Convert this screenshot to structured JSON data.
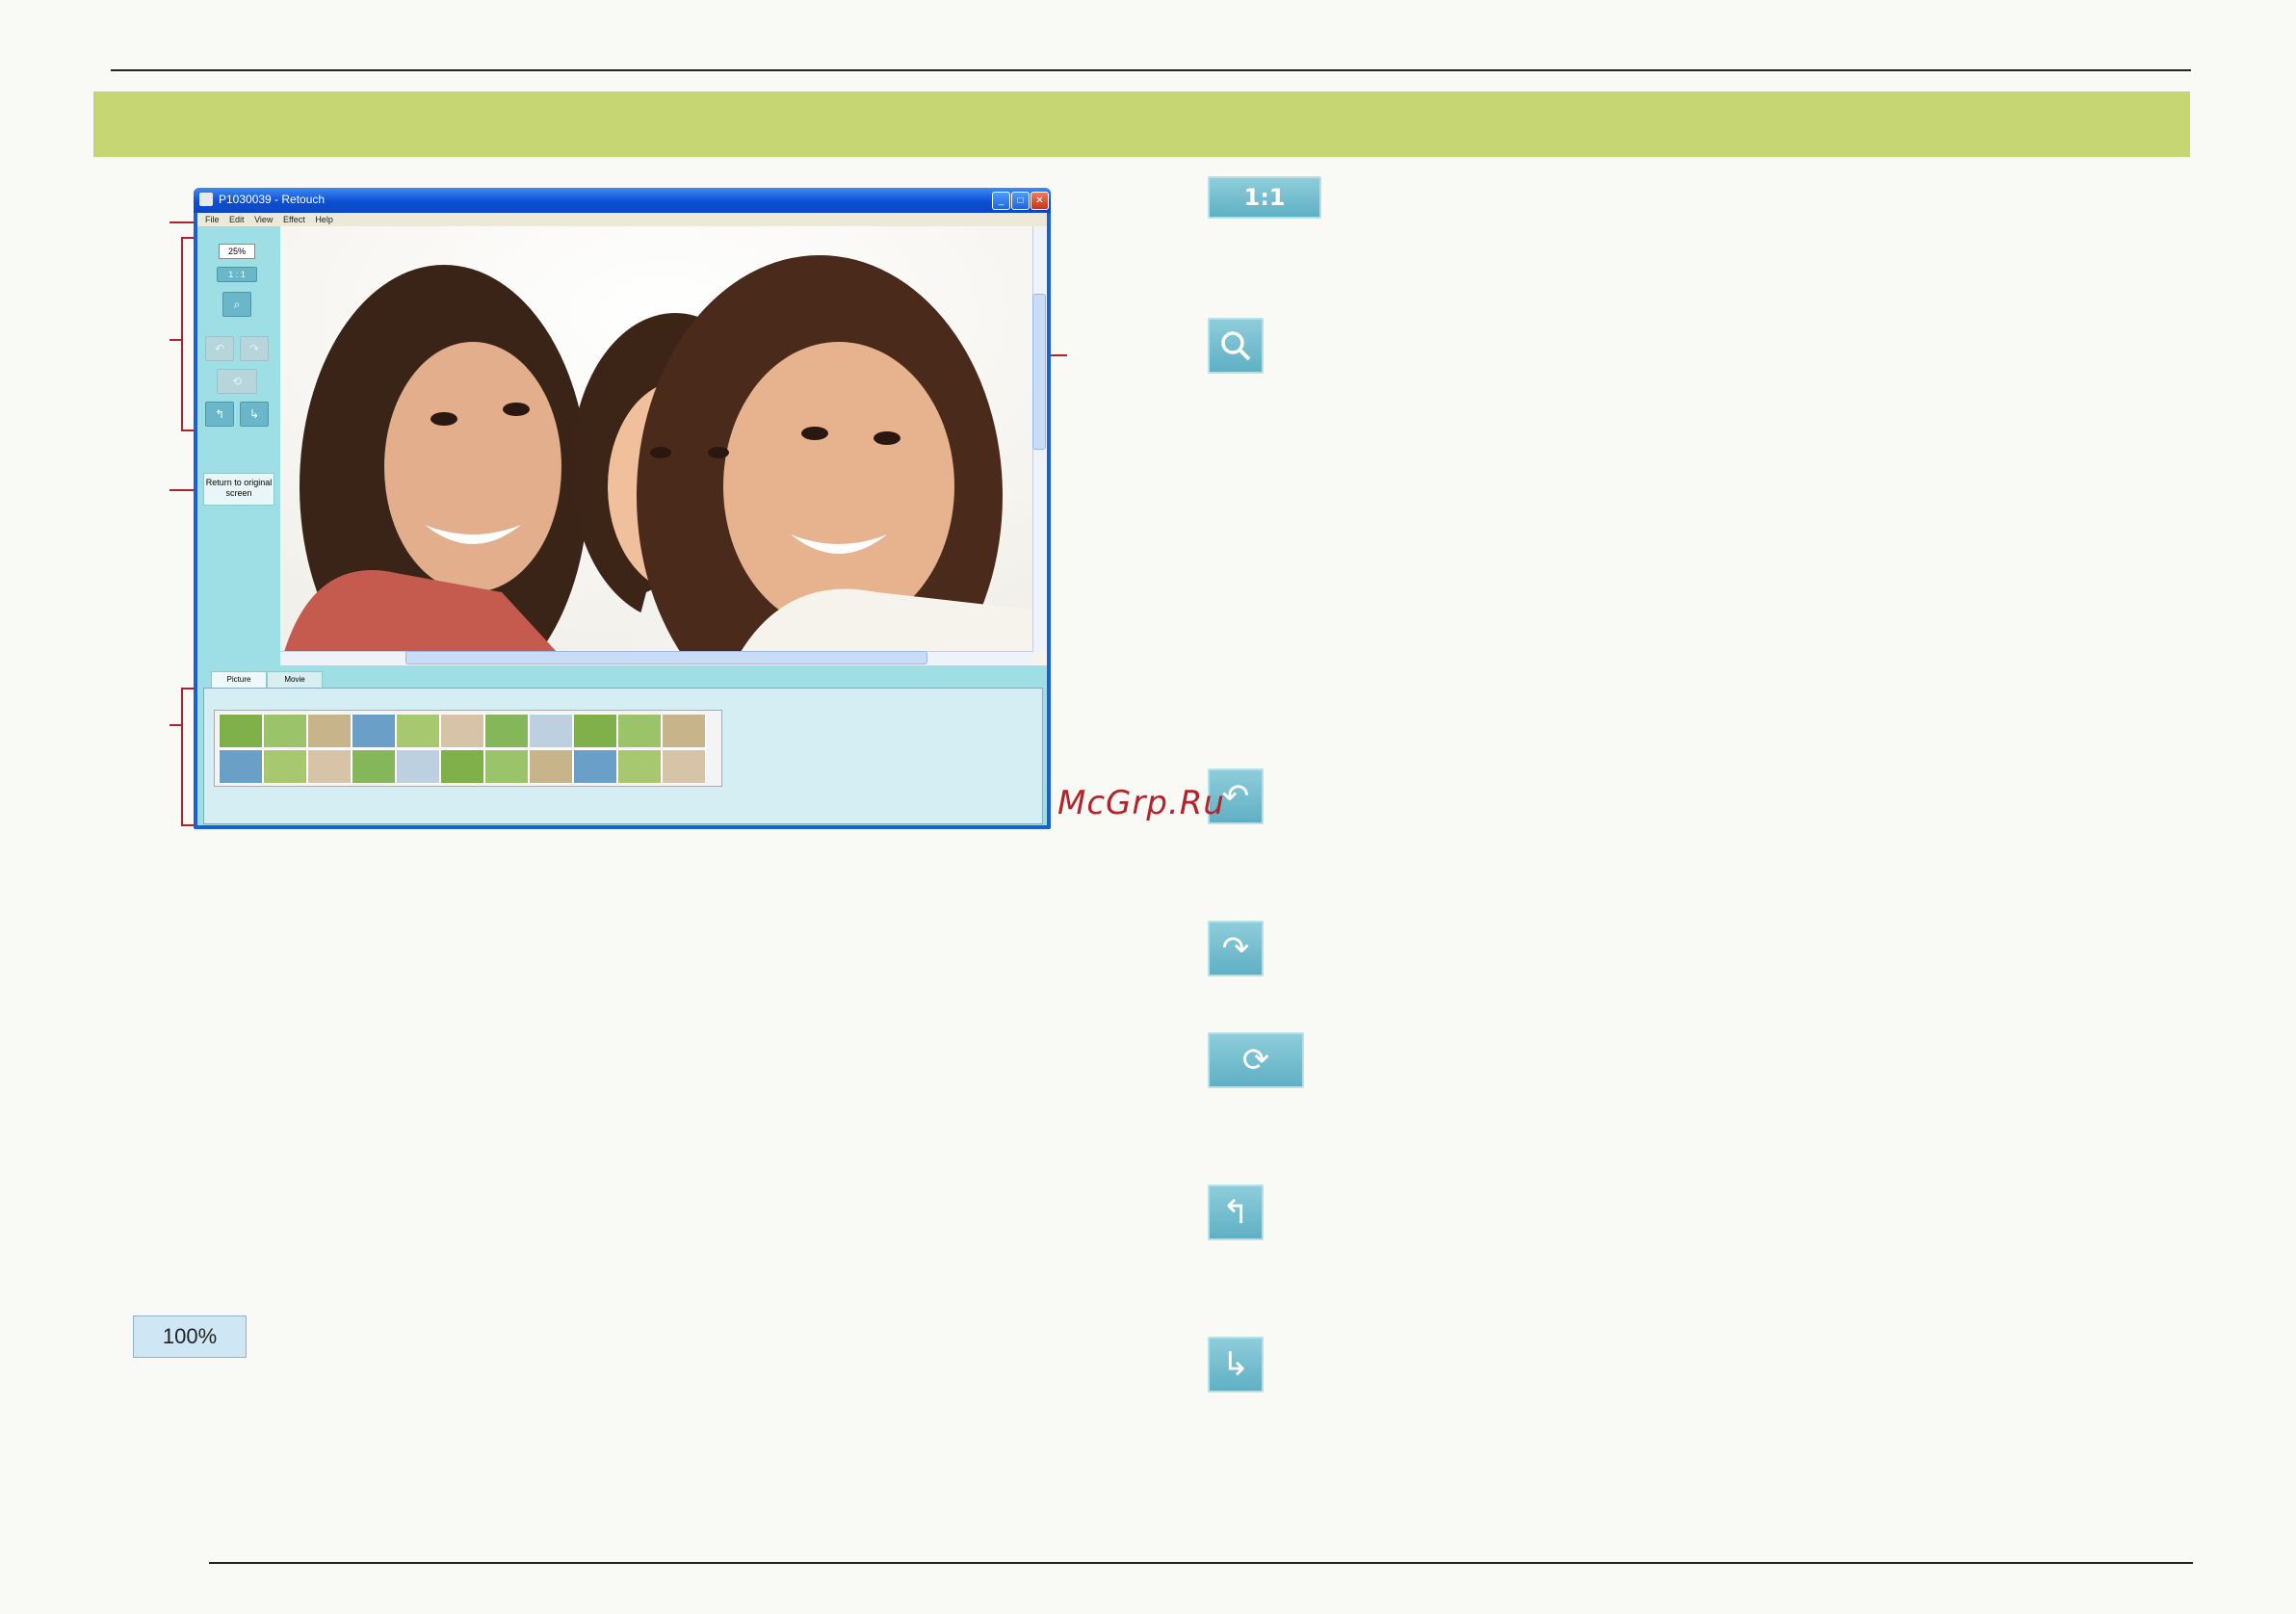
{
  "window": {
    "title": "P1030039 - Retouch",
    "menu": [
      "File",
      "Edit",
      "View",
      "Effect",
      "Help"
    ],
    "controls": {
      "minimize": "_",
      "maximize": "□",
      "close": "✕"
    }
  },
  "toolbar": {
    "zoom_value": "25%",
    "one_to_one": "1 : 1",
    "return_button": "Return to original screen"
  },
  "tabs": [
    "Picture",
    "Movie"
  ],
  "icons": {
    "one_to_one_label": "1:1",
    "zoom_level": "100%"
  },
  "watermark": "McGrp.Ru",
  "colors": {
    "header_band": "#c5d673",
    "panel": "#9edfe5",
    "callout": "#b0222a",
    "button": "#6ab7c9"
  }
}
